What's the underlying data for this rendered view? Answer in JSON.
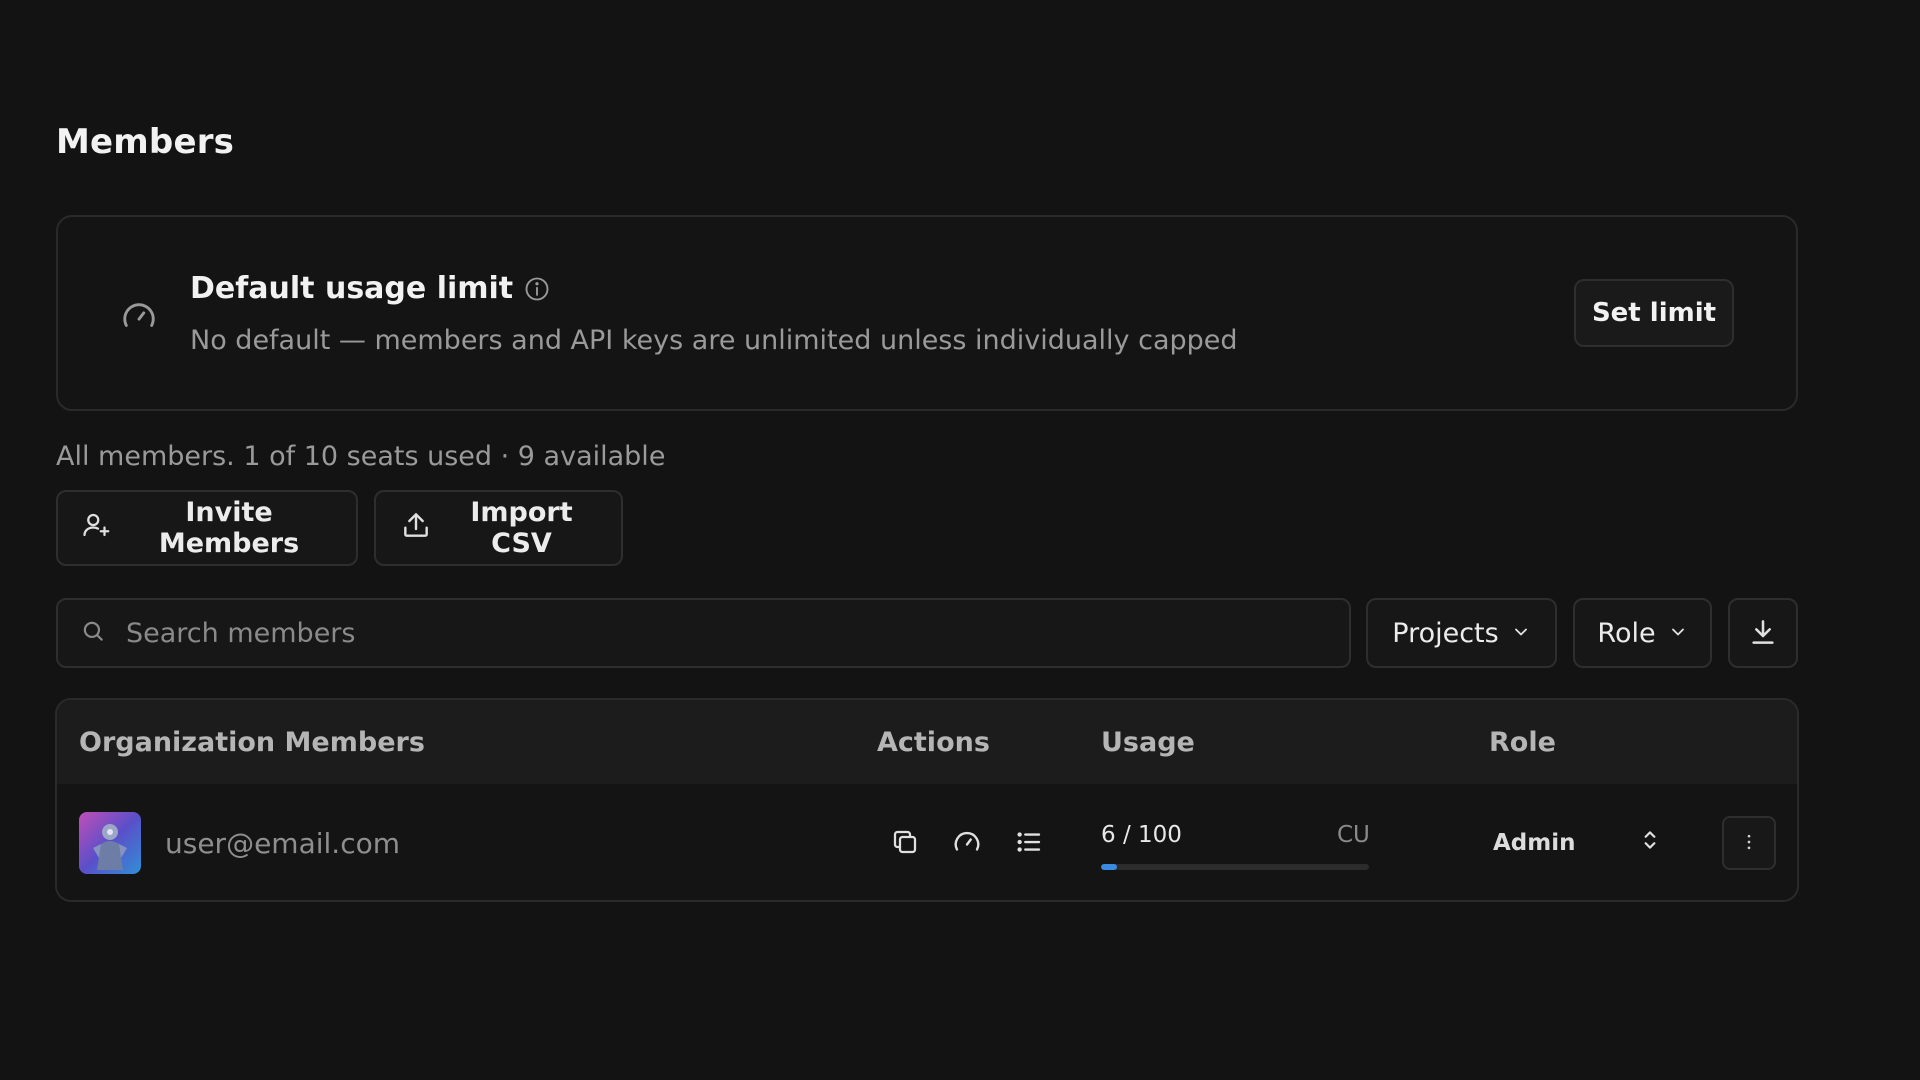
{
  "page": {
    "title": "Members"
  },
  "limit_card": {
    "title": "Default usage limit",
    "description": "No default — members and API keys are unlimited unless individually capped",
    "button_label": "Set limit",
    "icon": "gauge-icon",
    "info_icon": "info-icon"
  },
  "seats": {
    "summary": "All members. 1 of 10 seats used · 9 available"
  },
  "toolbar": {
    "invite_label": "Invite Members",
    "import_label": "Import CSV"
  },
  "filters": {
    "search_placeholder": "Search members",
    "projects_label": "Projects",
    "role_label": "Role"
  },
  "table": {
    "headers": {
      "members": "Organization Members",
      "actions": "Actions",
      "usage": "Usage",
      "role": "Role"
    },
    "rows": [
      {
        "email": "user@email.com",
        "usage_text": "6 / 100",
        "usage_unit": "CU",
        "usage_fraction": 0.06,
        "role": "Admin"
      }
    ]
  },
  "colors": {
    "background": "#131313",
    "accent": "#3a8be0",
    "border": "#2e2e2e"
  }
}
